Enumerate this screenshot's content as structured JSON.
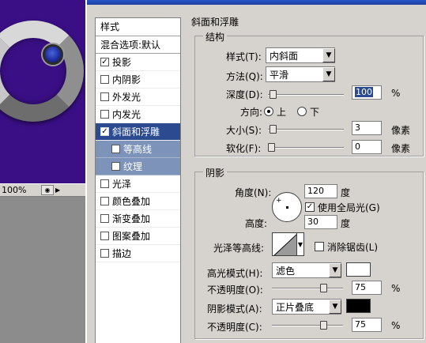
{
  "canvas": {
    "zoom": "100%",
    "colors": {
      "background": "#3a0f86",
      "knob": "#2136b0"
    }
  },
  "style_list": {
    "header": "样式",
    "blend_options": "混合选项:默认",
    "items": [
      {
        "label": "投影",
        "checked": true,
        "state": "normal"
      },
      {
        "label": "内阴影",
        "checked": false,
        "state": "normal"
      },
      {
        "label": "外发光",
        "checked": false,
        "state": "normal"
      },
      {
        "label": "内发光",
        "checked": false,
        "state": "normal"
      },
      {
        "label": "斜面和浮雕",
        "checked": true,
        "state": "selected"
      },
      {
        "label": "等高线",
        "checked": false,
        "state": "sub"
      },
      {
        "label": "纹理",
        "checked": false,
        "state": "sub"
      },
      {
        "label": "光泽",
        "checked": false,
        "state": "normal"
      },
      {
        "label": "颜色叠加",
        "checked": false,
        "state": "normal"
      },
      {
        "label": "渐变叠加",
        "checked": false,
        "state": "normal"
      },
      {
        "label": "图案叠加",
        "checked": false,
        "state": "normal"
      },
      {
        "label": "描边",
        "checked": false,
        "state": "normal"
      }
    ]
  },
  "panel": {
    "title": "斜面和浮雕",
    "structure": {
      "legend": "结构",
      "style_label": "样式(T):",
      "style_value": "内斜面",
      "technique_label": "方法(Q):",
      "technique_value": "平滑",
      "depth_label": "深度(D):",
      "depth_value": "100",
      "depth_unit": "%",
      "depth_level": 0.02,
      "direction_label": "方向:",
      "direction_up": "上",
      "direction_down": "下",
      "direction_selected": "up",
      "size_label": "大小(S):",
      "size_value": "3",
      "size_unit": "像素",
      "size_level": 0.02,
      "soften_label": "软化(F):",
      "soften_value": "0",
      "soften_unit": "像素",
      "soften_level": 0.0
    },
    "shading": {
      "legend": "阴影",
      "angle_label": "角度(N):",
      "angle_value": "120",
      "angle_unit": "度",
      "global_light_label": "使用全局光(G)",
      "global_light_checked": true,
      "altitude_label": "高度:",
      "altitude_value": "30",
      "altitude_unit": "度",
      "gloss_contour_label": "光泽等高线:",
      "anti_aliased_label": "消除锯齿(L)",
      "anti_aliased_checked": false,
      "highlight_mode_label": "高光模式(H):",
      "highlight_mode_value": "滤色",
      "highlight_color": "#ffffff",
      "highlight_opacity_label": "不透明度(O):",
      "highlight_opacity_value": "75",
      "highlight_opacity_unit": "%",
      "highlight_opacity_level": 0.75,
      "shadow_mode_label": "阴影模式(A):",
      "shadow_mode_value": "正片叠底",
      "shadow_color": "#000000",
      "shadow_opacity_label": "不透明度(C):",
      "shadow_opacity_value": "75",
      "shadow_opacity_unit": "%",
      "shadow_opacity_level": 0.75
    }
  }
}
